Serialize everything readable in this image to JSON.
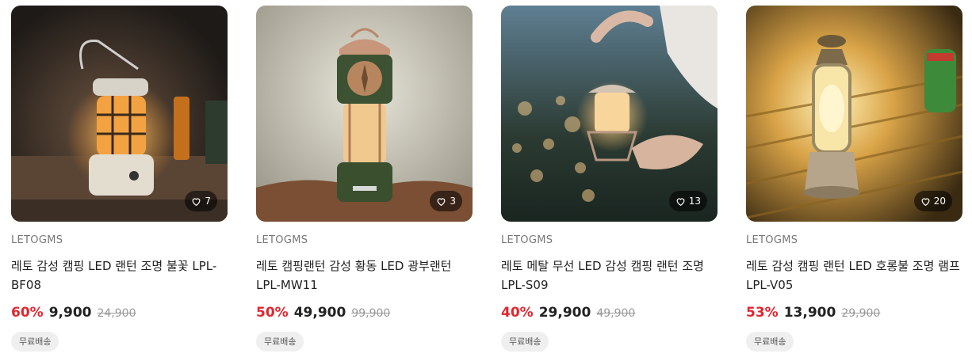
{
  "products": [
    {
      "brand": "LETOGMS",
      "title": "레토 감성 캠핑 LED 랜턴 조명 불꽃 LPL-BF08",
      "discount": "60%",
      "price": "9,900",
      "original_price": "24,900",
      "likes": "7",
      "shipping": "무료배송",
      "image_icon": "lantern-photo-icon"
    },
    {
      "brand": "LETOGMS",
      "title": "레토 캠핑랜턴 감성 황동 LED 광부랜턴 LPL-MW11",
      "discount": "50%",
      "price": "49,900",
      "original_price": "99,900",
      "likes": "3",
      "shipping": "무료배송",
      "image_icon": "lantern-photo-icon"
    },
    {
      "brand": "LETOGMS",
      "title": "레토 메탈 무선 LED 감성 캠핑 랜턴 조명 LPL-S09",
      "discount": "40%",
      "price": "29,900",
      "original_price": "49,900",
      "likes": "13",
      "shipping": "무료배송",
      "image_icon": "lantern-photo-icon"
    },
    {
      "brand": "LETOGMS",
      "title": "레토 감성 캠핑 랜턴 LED 호롱불 조명 램프 LPL-V05",
      "discount": "53%",
      "price": "13,900",
      "original_price": "29,900",
      "likes": "20",
      "shipping": "무료배송",
      "image_icon": "lantern-photo-icon"
    }
  ],
  "colors": {
    "discount": "#e2262f",
    "badge_bg": "#efefef",
    "brand_text": "#777777"
  },
  "like_icon": "heart-outline-icon"
}
